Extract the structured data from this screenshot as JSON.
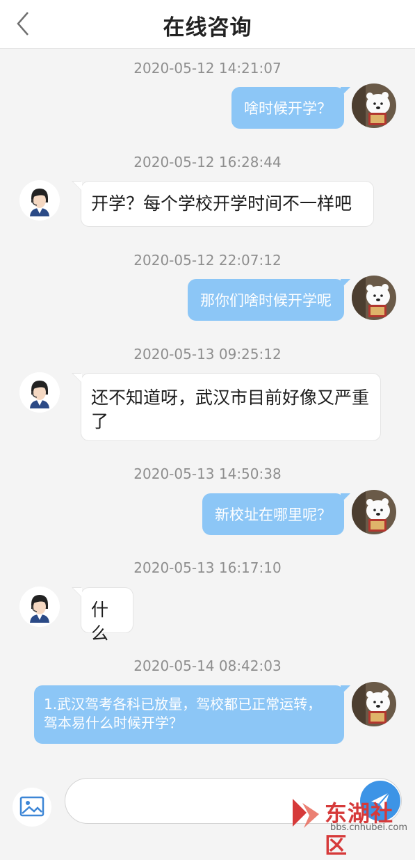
{
  "header": {
    "title": "在线咨询",
    "back_icon": "chevron-left-icon"
  },
  "colors": {
    "outgoing_bubble": "#8cc6f6",
    "incoming_bubble": "#ffffff",
    "send_button": "#3d94e6",
    "watermark": "#d63a3a"
  },
  "messages": [
    {
      "time": "2020-05-12 14:21:07",
      "from": "user",
      "text": "啥时候开学？"
    },
    {
      "time": "2020-05-12 16:28:44",
      "from": "agent",
      "text": "开学？每个学校开学时间不一样吧"
    },
    {
      "time": "2020-05-12 22:07:12",
      "from": "user",
      "text": "那你们啥时候开学呢"
    },
    {
      "time": "2020-05-13 09:25:12",
      "from": "agent",
      "text": "还不知道呀，武汉市目前好像又严重了"
    },
    {
      "time": "2020-05-13 14:50:38",
      "from": "user",
      "text": "新校址在哪里呢？"
    },
    {
      "time": "2020-05-13 16:17:10",
      "from": "agent",
      "text": "什么"
    },
    {
      "time": "2020-05-14 08:42:03",
      "from": "user",
      "text": "1.武汉驾考各科已放量，驾校都已正常运转，驾本易什么时候开学？"
    }
  ],
  "input": {
    "placeholder": "",
    "image_icon": "image-icon",
    "send_icon": "send-icon"
  },
  "watermark": {
    "brand": "东湖社区",
    "url": "bbs.cnhubei.com"
  }
}
